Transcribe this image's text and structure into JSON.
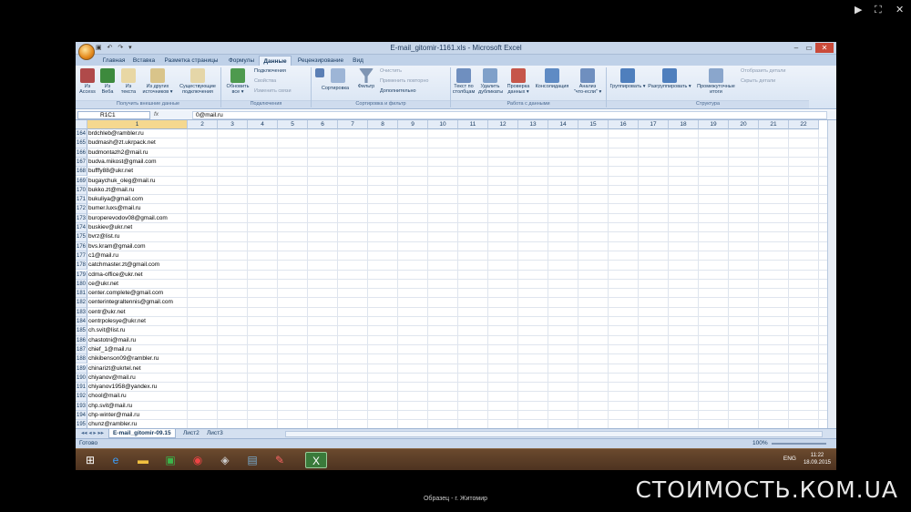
{
  "viewer": {
    "controls": [
      "▶",
      "⛶",
      "✕"
    ]
  },
  "window": {
    "title": "E-mail_gitomir-1161.xls - Microsoft Excel",
    "qat": "▣ ↶ ↷ ▾",
    "buttons": [
      "–",
      "▭",
      "✕"
    ]
  },
  "tabs": [
    {
      "label": "Главная"
    },
    {
      "label": "Вставка"
    },
    {
      "label": "Разметка страницы"
    },
    {
      "label": "Формулы"
    },
    {
      "label": "Данные",
      "active": true
    },
    {
      "label": "Рецензирование"
    },
    {
      "label": "Вид"
    }
  ],
  "ribbon": {
    "get_external": {
      "access": "Из Access",
      "web": "Из Веба",
      "text": "Из текста",
      "other": "Из других источников ▾",
      "existing": "Существующие подключения",
      "group": "Получить внешние данные"
    },
    "connections": {
      "refresh": "Обновить все ▾",
      "conn": "Подключения",
      "props": "Свойства",
      "edit": "Изменить связи",
      "group": "Подключения"
    },
    "sort_filter": {
      "sort": "Сортировка",
      "filter": "Фильтр",
      "clear": "Очистить",
      "reapply": "Применить повторно",
      "advanced": "Дополнительно",
      "group": "Сортировка и фильтр"
    },
    "data_tools": {
      "text_cols": "Текст по столбцам",
      "dups": "Удалить дубликаты",
      "validate": "Проверка данных ▾",
      "consolidate": "Консолидация",
      "whatif": "Анализ \"что-если\" ▾",
      "group": "Работа с данными"
    },
    "outline": {
      "group_btn": "Группировать ▾",
      "ungroup": "Разгруппировать ▾",
      "subtotal": "Промежуточные итоги",
      "show": "Отобразить детали",
      "hide": "Скрыть детали",
      "group": "Структура"
    }
  },
  "formula_bar": {
    "name_box": "R1C1",
    "fx": "fx",
    "content": "0@mail.ru"
  },
  "columns": [
    "1",
    "2",
    "3",
    "4",
    "5",
    "6",
    "7",
    "8",
    "9",
    "10",
    "11",
    "12",
    "13",
    "14",
    "15",
    "16",
    "17",
    "18",
    "19",
    "20",
    "21",
    "22"
  ],
  "rows": [
    {
      "n": "164",
      "v": "brdchleb@rambler.ru"
    },
    {
      "n": "165",
      "v": "budmash@zt.ukrpack.net"
    },
    {
      "n": "166",
      "v": "budmontazh2@mail.ru"
    },
    {
      "n": "167",
      "v": "budva.mikost@gmail.com"
    },
    {
      "n": "168",
      "v": "bufffy88@ukr.net"
    },
    {
      "n": "169",
      "v": "bugaychuk_oleg@mail.ru"
    },
    {
      "n": "170",
      "v": "bukko.zt@mail.ru"
    },
    {
      "n": "171",
      "v": "bukuliya@gmail.com"
    },
    {
      "n": "172",
      "v": "bumer.luxs@mail.ru"
    },
    {
      "n": "173",
      "v": "buroperevodov08@gmail.com"
    },
    {
      "n": "174",
      "v": "buskiev@ukr.net"
    },
    {
      "n": "175",
      "v": "bvrz@list.ru"
    },
    {
      "n": "176",
      "v": "bvs.kram@gmail.com"
    },
    {
      "n": "177",
      "v": "c1@mail.ru"
    },
    {
      "n": "178",
      "v": "catchmaster.zt@gmail.com"
    },
    {
      "n": "179",
      "v": "cdma-office@ukr.net"
    },
    {
      "n": "180",
      "v": "ce@ukr.net"
    },
    {
      "n": "181",
      "v": "center.complete@gmail.com"
    },
    {
      "n": "182",
      "v": "centerintegraltennis@gmail.com"
    },
    {
      "n": "183",
      "v": "centr@ukr.net"
    },
    {
      "n": "184",
      "v": "centrpolesye@ukr.net"
    },
    {
      "n": "185",
      "v": "ch.svit@list.ru"
    },
    {
      "n": "186",
      "v": "chastotni@mail.ru"
    },
    {
      "n": "187",
      "v": "chief_1@mail.ru"
    },
    {
      "n": "188",
      "v": "chikibenson09@rambler.ru"
    },
    {
      "n": "189",
      "v": "chinarizt@ukrtel.net"
    },
    {
      "n": "190",
      "v": "chiyanov@mail.ru"
    },
    {
      "n": "191",
      "v": "chiyanov1958@yandex.ru"
    },
    {
      "n": "192",
      "v": "chool@mail.ru"
    },
    {
      "n": "193",
      "v": "chp.svit@mail.ru"
    },
    {
      "n": "194",
      "v": "chp-winter@mail.ru"
    },
    {
      "n": "195",
      "v": "chunz@rambler.ru"
    }
  ],
  "sheets": [
    "E-mail_gitomir-09.15",
    "Лист2",
    "Лист3"
  ],
  "sheet_nav": "◂◂ ◂ ▸ ▸▸",
  "status": {
    "ready": "Готово",
    "zoom": "100%"
  },
  "taskbar": {
    "lang": "ENG",
    "time": "11:22",
    "date": "18.09.2015"
  },
  "caption": "Образец - г. Житомир",
  "watermark": "СТОИМОСТЬ.КОМ.UA",
  "colors": {
    "ribbon": "#d8e4f3",
    "taskbar": "#5a3d26",
    "excel_green": "#217346"
  }
}
